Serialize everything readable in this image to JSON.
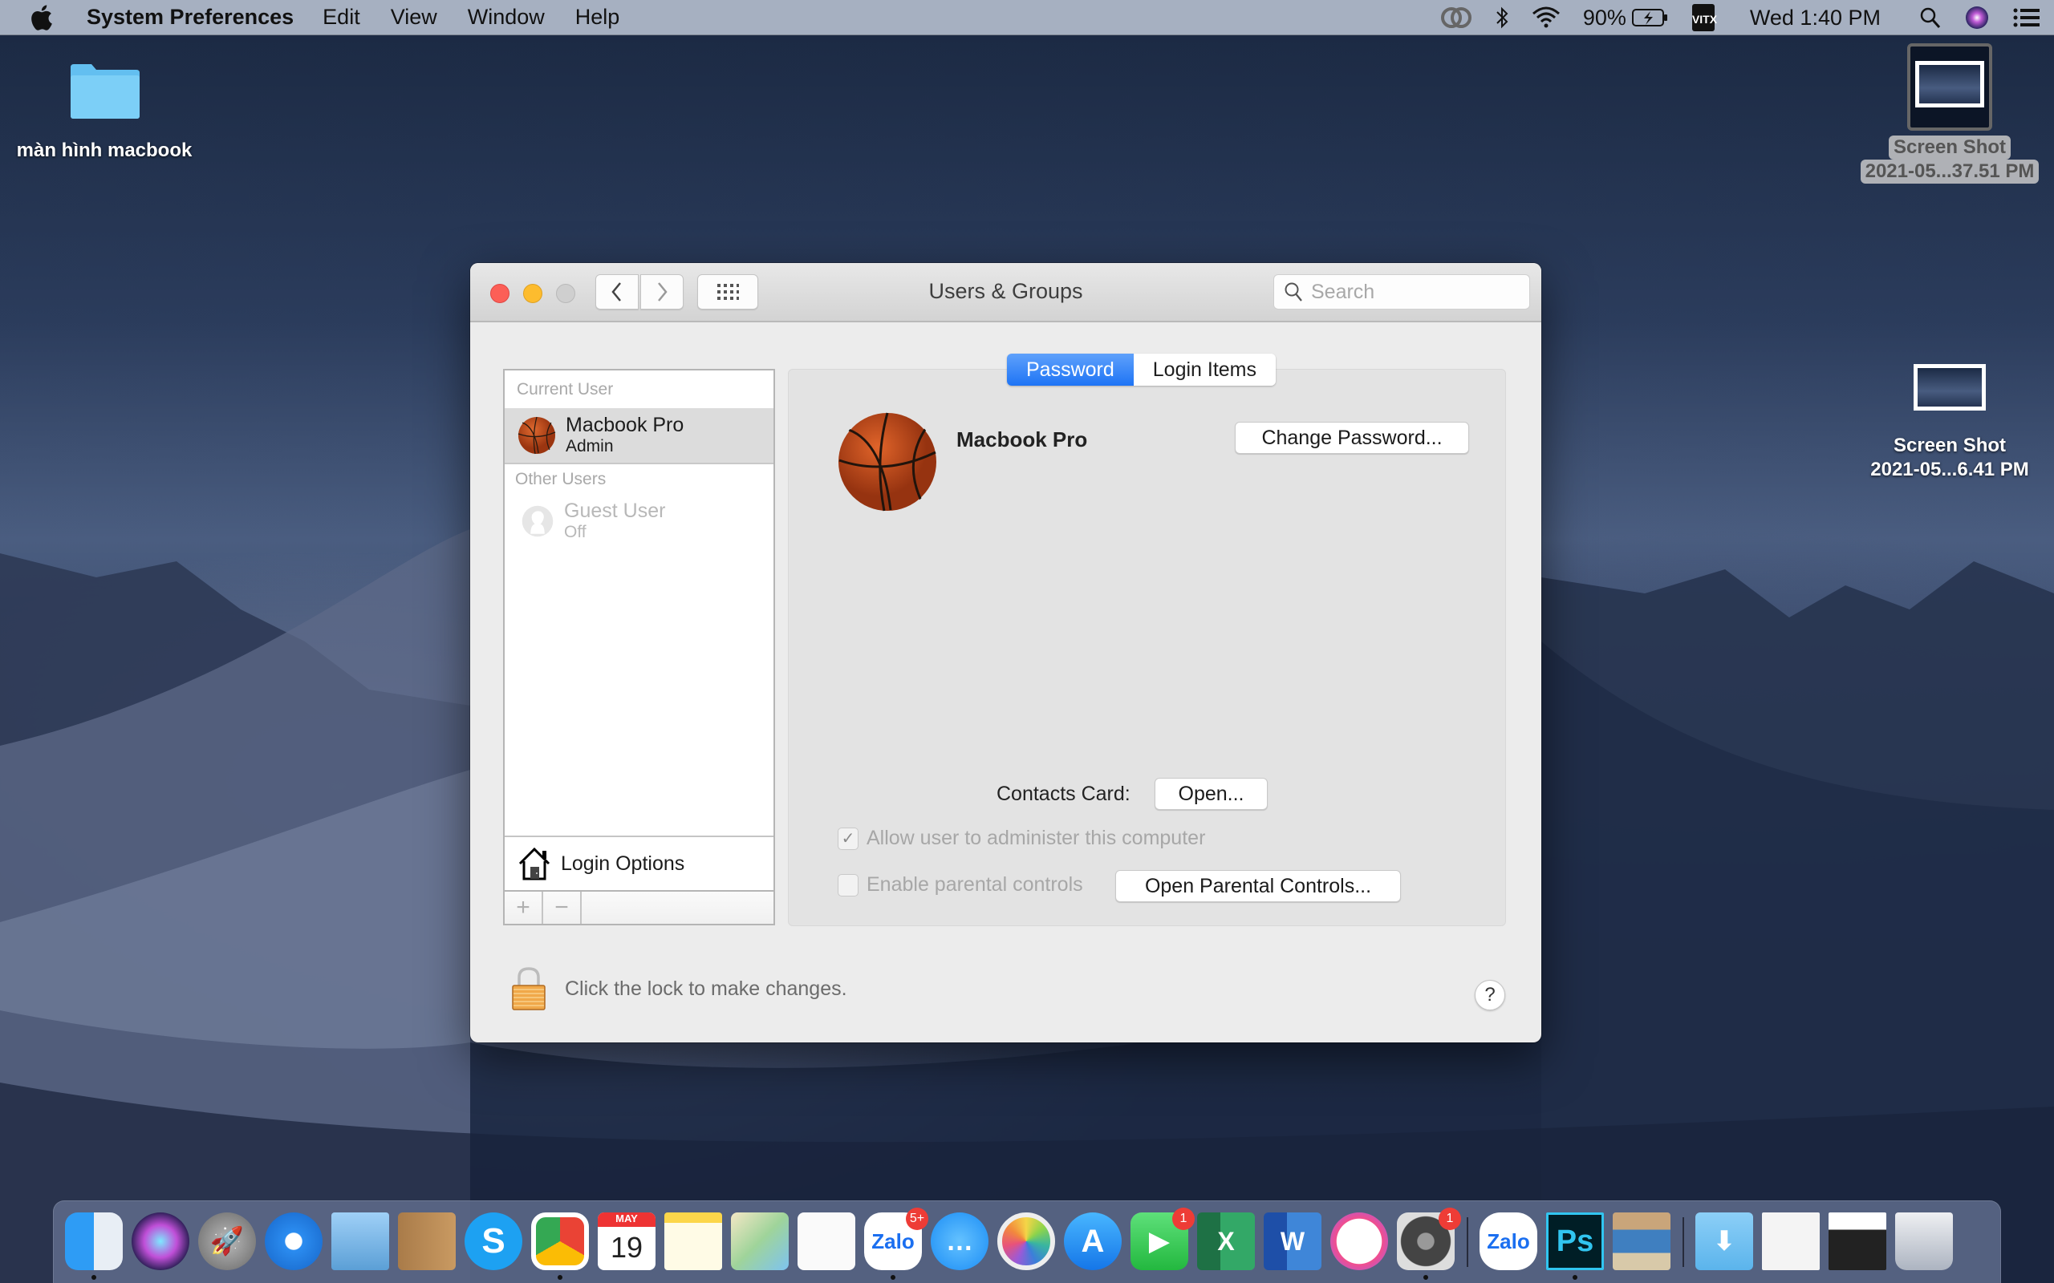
{
  "menubar": {
    "app_name": "System Preferences",
    "menus": [
      "Edit",
      "View",
      "Window",
      "Help"
    ],
    "status": {
      "battery_percent": "90%",
      "input_method": "VI\nTX",
      "input_top": "VI",
      "input_bottom": "TX",
      "clock": "Wed 1:40 PM"
    },
    "status_icons": [
      "creative-cloud-icon",
      "bluetooth-icon",
      "wifi-icon",
      "battery-charging-icon",
      "input-method-icon",
      "spotlight-search-icon",
      "siri-icon",
      "notification-center-icon"
    ]
  },
  "desktop": {
    "items": [
      {
        "label": "màn hình macbook",
        "type": "folder"
      },
      {
        "label_line1": "Screen Shot",
        "label_line2": "2021-05...37.51 PM",
        "type": "screenshot",
        "selected": true
      },
      {
        "label_line1": "Screen Shot",
        "label_line2": "2021-05...6.41 PM",
        "type": "screenshot",
        "selected": false
      }
    ]
  },
  "window": {
    "title": "Users & Groups",
    "search_placeholder": "Search",
    "sidebar": {
      "current_user_header": "Current User",
      "current_user": {
        "name": "Macbook Pro",
        "role": "Admin"
      },
      "other_users_header": "Other Users",
      "other_users": [
        {
          "name": "Guest User",
          "status": "Off"
        }
      ],
      "login_options_label": "Login Options",
      "add_label": "+",
      "remove_label": "−"
    },
    "tabs": [
      {
        "label": "Password",
        "active": true
      },
      {
        "label": "Login Items",
        "active": false
      }
    ],
    "pane": {
      "user_name": "Macbook Pro",
      "change_password_label": "Change Password...",
      "contacts_card_label": "Contacts Card:",
      "open_label": "Open...",
      "allow_admin_label": "Allow user to administer this computer",
      "allow_admin_checked": true,
      "parental_label": "Enable parental controls",
      "parental_checked": false,
      "open_parental_label": "Open Parental Controls..."
    },
    "lock_text": "Click the lock to make changes.",
    "help_label": "?"
  },
  "dock": {
    "apps": [
      {
        "name": "Finder",
        "running": true
      },
      {
        "name": "Siri"
      },
      {
        "name": "Launchpad"
      },
      {
        "name": "Safari"
      },
      {
        "name": "Mail"
      },
      {
        "name": "Contacts"
      },
      {
        "name": "Skype",
        "text": "S"
      },
      {
        "name": "Google Chrome",
        "running": true
      },
      {
        "name": "Calendar",
        "month": "MAY",
        "day": "19"
      },
      {
        "name": "Notes"
      },
      {
        "name": "Maps"
      },
      {
        "name": "Reminders"
      },
      {
        "name": "Zalo",
        "text": "Zalo",
        "badge": "5+",
        "running": true
      },
      {
        "name": "Messages"
      },
      {
        "name": "Photos"
      },
      {
        "name": "App Store"
      },
      {
        "name": "FaceTime",
        "badge": "1"
      },
      {
        "name": "Microsoft Excel",
        "text": "X"
      },
      {
        "name": "Microsoft Word",
        "text": "W"
      },
      {
        "name": "iTunes"
      },
      {
        "name": "System Preferences",
        "badge": "1",
        "running": true
      },
      {
        "name": "Zalo",
        "text": "Zalo"
      },
      {
        "name": "Adobe Photoshop",
        "text": "Ps",
        "running": true
      },
      {
        "name": "Preview"
      },
      {
        "name": "Downloads"
      },
      {
        "name": "Finder Window"
      },
      {
        "name": "Chrome Window"
      },
      {
        "name": "Trash"
      }
    ]
  }
}
